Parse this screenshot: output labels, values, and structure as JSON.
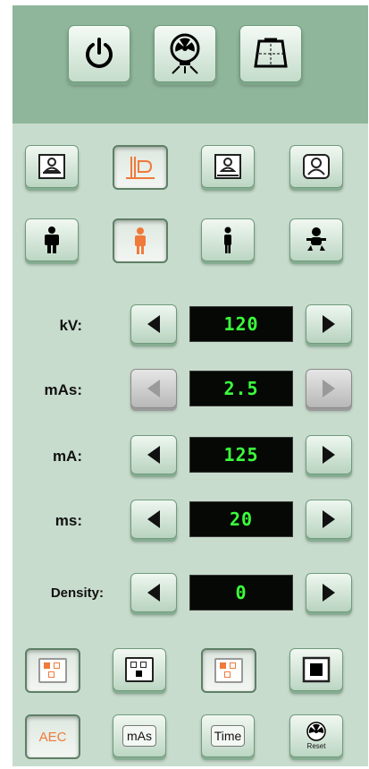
{
  "toolbar": {
    "buttons": [
      {
        "name": "power",
        "icon": "power-icon"
      },
      {
        "name": "xray",
        "icon": "xray-tube-icon"
      },
      {
        "name": "detector",
        "icon": "detector-plate-icon"
      }
    ]
  },
  "positions": {
    "row1": [
      {
        "icon": "table-patient-icon",
        "active": false
      },
      {
        "icon": "wall-stand-icon",
        "active": true
      },
      {
        "icon": "table-patient-alt-icon",
        "active": false
      },
      {
        "icon": "head-portrait-icon",
        "active": false
      }
    ]
  },
  "body_size": [
    {
      "icon": "large-body-icon",
      "active": false
    },
    {
      "icon": "medium-body-icon",
      "active": true
    },
    {
      "icon": "slim-body-icon",
      "active": false
    },
    {
      "icon": "child-icon",
      "active": false
    }
  ],
  "params": [
    {
      "label": "kV:",
      "value": "120",
      "enabled": true
    },
    {
      "label": "mAs:",
      "value": "2.5",
      "enabled": false
    },
    {
      "label": "mA:",
      "value": "125",
      "enabled": true
    },
    {
      "label": "ms:",
      "value": "20",
      "enabled": true
    },
    {
      "label": "Density:",
      "value": "0",
      "enabled": true
    }
  ],
  "fields": [
    {
      "icon": "aec-fields-orange-icon",
      "active": true
    },
    {
      "icon": "aec-center-field-icon",
      "active": false
    },
    {
      "icon": "aec-fields-orange-alt-icon",
      "active": false
    },
    {
      "icon": "full-field-icon",
      "active": false
    }
  ],
  "modes": {
    "aec_label": "AEC",
    "mas_label": "mAs",
    "time_label": "Time",
    "reset_label": "Reset"
  },
  "colors": {
    "panel": "#c8dccd",
    "topbar": "#8fb69a",
    "display_text": "#3bff3b",
    "accent": "#f07a3a"
  }
}
